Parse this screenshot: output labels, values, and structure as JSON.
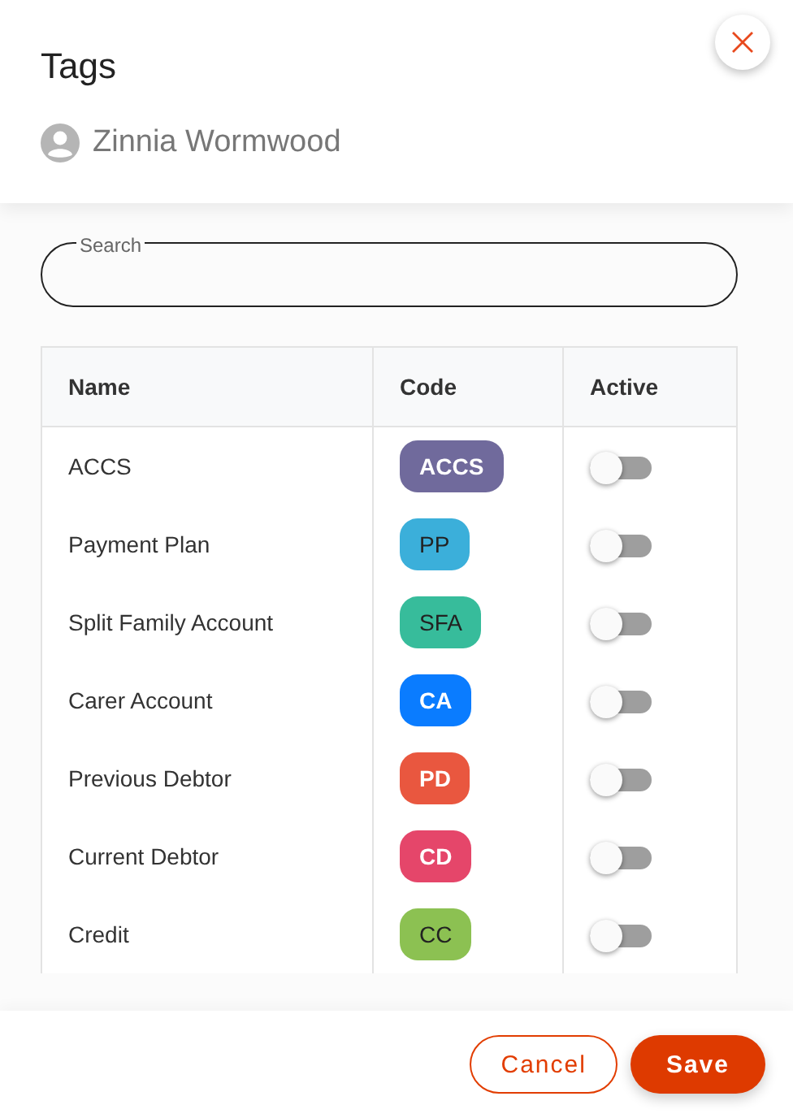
{
  "title": "Tags",
  "person": "Zinnia Wormwood",
  "search": {
    "label": "Search"
  },
  "table": {
    "columns": [
      "Name",
      "Code",
      "Active"
    ],
    "rows": [
      {
        "name": "ACCS",
        "code": "ACCS",
        "color": "#706a9c",
        "on": false
      },
      {
        "name": "Payment Plan",
        "code": "PP",
        "color": "#3bafda",
        "on": false
      },
      {
        "name": "Split Family Account",
        "code": "SFA",
        "color": "#37bc9b",
        "on": false
      },
      {
        "name": "Carer Account",
        "code": "CA",
        "color": "#0a7cff",
        "on": false
      },
      {
        "name": "Previous Debtor",
        "code": "PD",
        "color": "#e9573f",
        "on": false
      },
      {
        "name": "Current Debtor",
        "code": "CD",
        "color": "#e5466a",
        "on": false
      },
      {
        "name": "Credit",
        "code": "CC",
        "color": "#8cc152",
        "on": false
      }
    ]
  },
  "buttons": {
    "cancel": "Cancel",
    "save": "Save"
  }
}
